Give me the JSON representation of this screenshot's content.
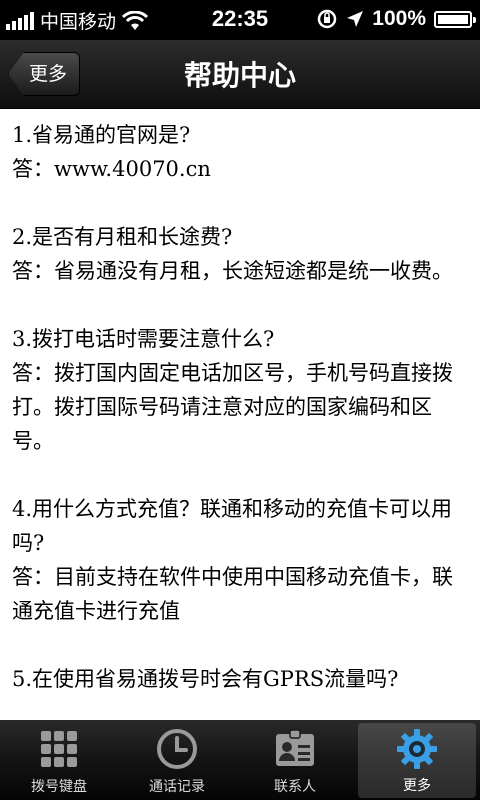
{
  "status_bar": {
    "carrier": "中国移动",
    "time": "22:35",
    "battery": "100%",
    "battery_level": 1.0
  },
  "nav": {
    "back_label": "更多",
    "title": "帮助中心"
  },
  "faq": [
    {
      "q": "1.省易通的官网是?",
      "a": "答：www.40070.cn"
    },
    {
      "q": "2.是否有月租和长途费?",
      "a": "答：省易通没有月租，长途短途都是统一收费。"
    },
    {
      "q": "3.拨打电话时需要注意什么?",
      "a": "答：拨打国内固定电话加区号，手机号码直接拨打。拨打国际号码请注意对应的国家编码和区号。"
    },
    {
      "q": "4.用什么方式充值？联通和移动的充值卡可以用吗?",
      "a": "答：目前支持在软件中使用中国移动充值卡，联通充值卡进行充值"
    },
    {
      "q": "5.在使用省易通拨号时会有GPRS流量吗?",
      "a": ""
    }
  ],
  "tabs": [
    {
      "label": "拨号键盘",
      "icon": "keypad-icon",
      "active": false
    },
    {
      "label": "通话记录",
      "icon": "clock-icon",
      "active": false
    },
    {
      "label": "联系人",
      "icon": "contacts-icon",
      "active": false
    },
    {
      "label": "更多",
      "icon": "gear-icon",
      "active": true
    }
  ],
  "colors": {
    "active_tab_accent": "#3aa0e6"
  }
}
